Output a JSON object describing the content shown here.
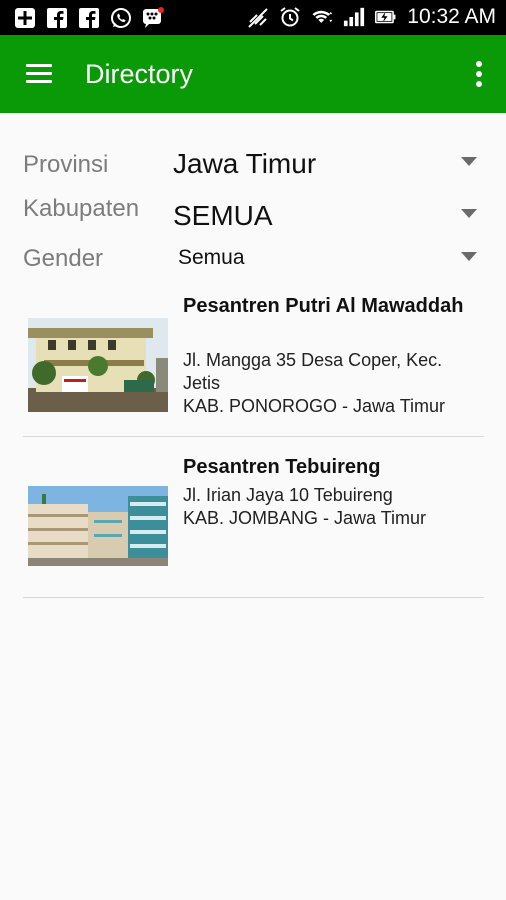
{
  "status_bar": {
    "time": "10:32 AM",
    "left_icons": [
      "plus-square-icon",
      "facebook-icon",
      "facebook-icon",
      "whatsapp-icon",
      "bbm-icon"
    ],
    "right_icons": [
      "mute-icon",
      "alarm-icon",
      "wifi-icon",
      "signal-icon",
      "battery-charging-icon"
    ]
  },
  "appbar": {
    "title": "Directory",
    "background": "#0a9a07"
  },
  "filters": {
    "provinsi": {
      "label": "Provinsi",
      "value": "Jawa Timur"
    },
    "kabupaten": {
      "label": "Kabupaten",
      "value": "SEMUA"
    },
    "gender": {
      "label": "Gender",
      "value": "Semua"
    }
  },
  "items": [
    {
      "name": "Pesantren Putri Al Mawaddah",
      "address": "Jl. Mangga 35 Desa Coper, Kec. Jetis",
      "region": "KAB. PONOROGO - Jawa Timur"
    },
    {
      "name": "Pesantren Tebuireng",
      "address": "Jl. Irian Jaya 10 Tebuireng",
      "region": "KAB. JOMBANG - Jawa Timur"
    }
  ]
}
